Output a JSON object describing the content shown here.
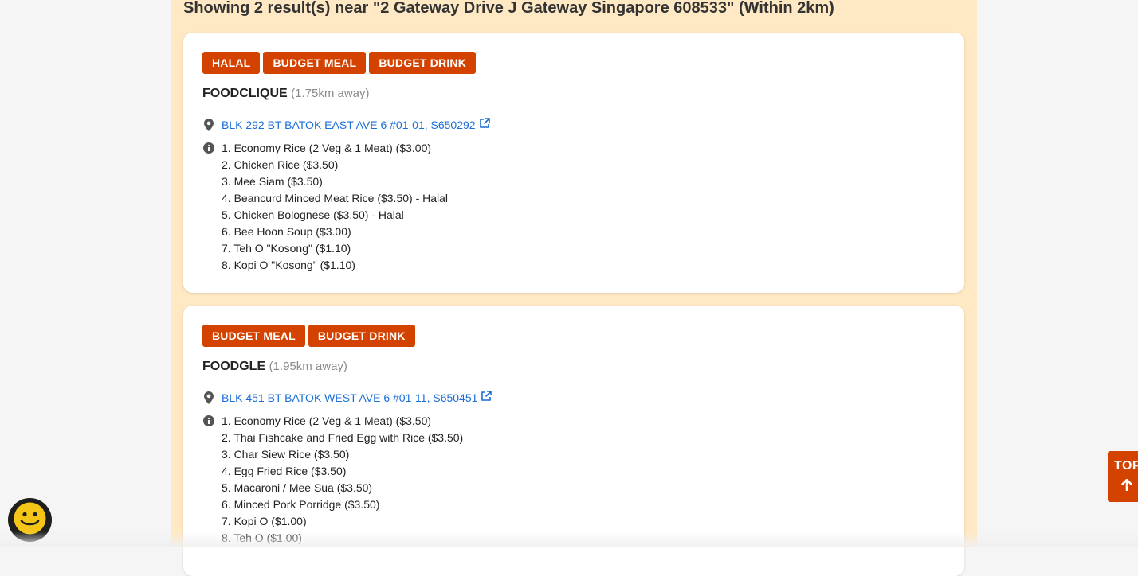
{
  "results": {
    "heading": "Showing 2 result(s) near \"2 Gateway Drive J Gateway Singapore 608533\" (Within 2km)"
  },
  "stalls": [
    {
      "tags": [
        "HALAL",
        "BUDGET MEAL",
        "BUDGET DRINK"
      ],
      "name": "FOODCLIQUE",
      "distance": "(1.75km away)",
      "address": "BLK 292 BT BATOK EAST AVE 6 #01-01, S650292",
      "menu": [
        "1. Economy Rice (2 Veg & 1 Meat) ($3.00)",
        "2. Chicken Rice ($3.50)",
        "3. Mee Siam ($3.50)",
        "4. Beancurd Minced Meat Rice ($3.50) - Halal",
        "5. Chicken Bolognese ($3.50) - Halal",
        "6. Bee Hoon Soup ($3.00)",
        "7. Teh O \"Kosong\" ($1.10)",
        "8. Kopi O \"Kosong\" ($1.10)"
      ]
    },
    {
      "tags": [
        "BUDGET MEAL",
        "BUDGET DRINK"
      ],
      "name": "FOODGLE",
      "distance": "(1.95km away)",
      "address": "BLK 451 BT BATOK WEST AVE 6 #01-11, S650451",
      "menu": [
        "1. Economy Rice (2 Veg & 1 Meat) ($3.50)",
        "2. Thai Fishcake and Fried Egg with Rice ($3.50)",
        "3. Char Siew Rice ($3.50)",
        "4. Egg Fried Rice ($3.50)",
        "5. Macaroni / Mee Sua ($3.50)",
        "6. Minced Pork Porridge ($3.50)",
        "7. Kopi O ($1.00)",
        "8. Teh O ($1.00)"
      ]
    }
  ],
  "top_button": {
    "label": "TOP",
    "icon": "arrow-up-icon"
  },
  "floating": {
    "icon": "smiley-face-icon"
  },
  "icons": {
    "address": "map-marker-icon",
    "external": "external-link-icon",
    "info": "info-circle-icon"
  },
  "colors": {
    "accent": "#d44200",
    "column_background": "#ffe8c4",
    "link": "#1a6ed8",
    "page_background": "#f5f5f5",
    "smiley": "#f5c518"
  }
}
